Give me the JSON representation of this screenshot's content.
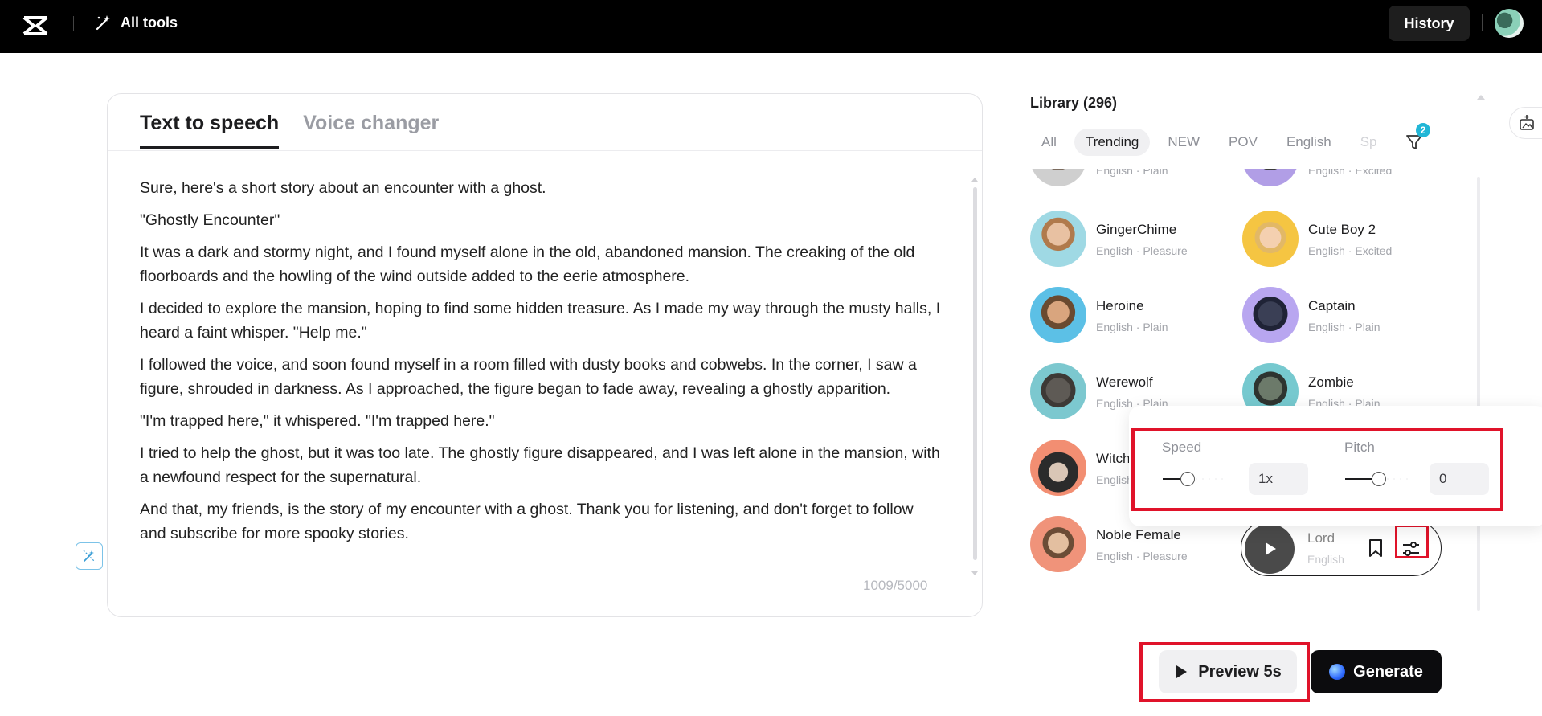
{
  "topbar": {
    "logo": "capcut-logo-icon",
    "all_tools_icon": "magic-wand-icon",
    "all_tools_label": "All tools",
    "history_label": "History",
    "avatar": "user-avatar"
  },
  "editor": {
    "tabs": [
      {
        "label": "Text to speech",
        "active": true
      },
      {
        "label": "Voice changer",
        "active": false
      }
    ],
    "paragraphs": [
      "Sure, here's a short story about an encounter with a ghost.",
      "\"Ghostly Encounter\"",
      "It was a dark and stormy night, and I found myself alone in the old, abandoned mansion. The creaking of the old floorboards and the howling of the wind outside added to the eerie atmosphere.",
      "I decided to explore the mansion, hoping to find some hidden treasure. As I made my way through the musty halls, I heard a faint whisper. \"Help me.\"",
      "I followed the voice, and soon found myself in a room filled with dusty books and cobwebs. In the corner, I saw a figure, shrouded in darkness. As I approached, the figure began to fade away, revealing a ghostly apparition.",
      "\"I'm trapped here,\" it whispered. \"I'm trapped here.\"",
      "I tried to help the ghost, but it was too late. The ghostly figure disappeared, and I was left alone in the mansion, with a newfound respect for the supernatural.",
      "And that, my friends, is the story of my encounter with a ghost. Thank you for listening, and don't forget to follow and subscribe for more spooky stories."
    ],
    "char_count": "1009/5000",
    "magic_icon": "magic-edit-icon"
  },
  "library": {
    "title": "Library (296)",
    "filters": [
      {
        "label": "All",
        "active": false
      },
      {
        "label": "Trending",
        "active": true
      },
      {
        "label": "NEW",
        "active": false
      },
      {
        "label": "POV",
        "active": false
      },
      {
        "label": "English",
        "active": false
      },
      {
        "label": "Sp",
        "active": false
      }
    ],
    "filter_badge": "2",
    "partial_top": [
      {
        "meta": "English · Plain"
      },
      {
        "meta": "English · Excited"
      }
    ],
    "voices": [
      {
        "name": "GingerChime",
        "meta": "English · Pleasure"
      },
      {
        "name": "Cute Boy 2",
        "meta": "English · Excited"
      },
      {
        "name": "Heroine",
        "meta": "English · Plain"
      },
      {
        "name": "Captain",
        "meta": "English · Plain"
      },
      {
        "name": "Werewolf",
        "meta": "English · Plain"
      },
      {
        "name": "Zombie",
        "meta": "English · Plain"
      },
      {
        "name": "Witch",
        "meta": "English"
      },
      {
        "name": "Noble Female",
        "meta": "English · Pleasure"
      }
    ],
    "playing": {
      "name": "Lord",
      "meta": "English"
    }
  },
  "adjust": {
    "speed_label": "Speed",
    "speed_value": "1x",
    "speed_level": 0.3,
    "pitch_label": "Pitch",
    "pitch_value": "0",
    "pitch_level": 0.5
  },
  "actions": {
    "preview_label": "Preview 5s",
    "generate_label": "Generate"
  },
  "colors": {
    "highlight": "#e0132a",
    "accent": "#21b6d6"
  }
}
